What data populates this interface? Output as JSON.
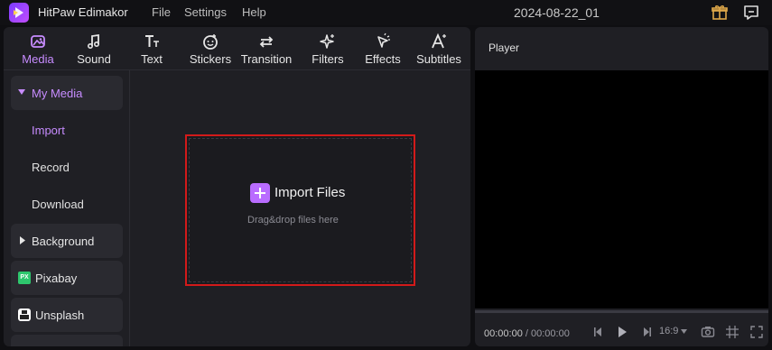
{
  "app": {
    "name": "HitPaw Edimakor",
    "project_title": "2024-08-22_01",
    "menu": [
      "File",
      "Settings",
      "Help"
    ]
  },
  "tabs": [
    {
      "label": "Media",
      "icon": "media-icon",
      "active": true
    },
    {
      "label": "Sound",
      "icon": "music-note-icon"
    },
    {
      "label": "Text",
      "icon": "text-icon"
    },
    {
      "label": "Stickers",
      "icon": "sticker-icon"
    },
    {
      "label": "Transition",
      "icon": "transition-arrows-icon"
    },
    {
      "label": "Filters",
      "icon": "sparkle-icon"
    },
    {
      "label": "Effects",
      "icon": "effects-icon"
    },
    {
      "label": "Subtitles",
      "icon": "subtitles-icon"
    }
  ],
  "sidebar": {
    "my_media": "My Media",
    "import": "Import",
    "record": "Record",
    "download": "Download",
    "background": "Background",
    "pixabay": "Pixabay",
    "pixabay_badge": "PX",
    "unsplash": "Unsplash"
  },
  "import_area": {
    "button_label": "Import Files",
    "hint": "Drag&drop files here"
  },
  "player": {
    "title": "Player",
    "current_time": "00:00:00",
    "separator": "/",
    "total_time": "00:00:00",
    "aspect_ratio": "16:9"
  },
  "colors": {
    "accent": "#c78cff",
    "highlight_border": "#d21a1a",
    "panel": "#1f1f24"
  }
}
